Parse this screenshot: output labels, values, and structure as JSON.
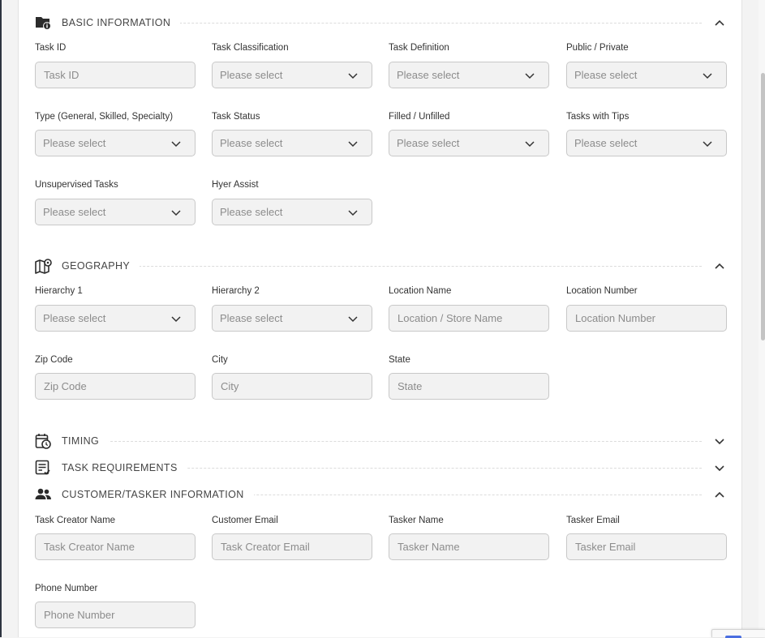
{
  "sections": {
    "basic": {
      "title": "BASIC INFORMATION",
      "icon": "folder-info-icon",
      "state": "expanded"
    },
    "geography": {
      "title": "GEOGRAPHY",
      "icon": "map-pin-icon",
      "state": "expanded"
    },
    "timing": {
      "title": "TIMING",
      "icon": "calendar-clock-icon",
      "state": "collapsed"
    },
    "requirements": {
      "title": "TASK REQUIREMENTS",
      "icon": "checklist-icon",
      "state": "collapsed"
    },
    "customer": {
      "title": "CUSTOMER/TASKER INFORMATION",
      "icon": "people-icon",
      "state": "expanded"
    }
  },
  "basic": {
    "task_id": {
      "label": "Task ID",
      "placeholder": "Task ID"
    },
    "task_classification": {
      "label": "Task Classification",
      "value": "Please select"
    },
    "task_definition": {
      "label": "Task Definition",
      "value": "Please select"
    },
    "public_private": {
      "label": "Public / Private",
      "value": "Please select"
    },
    "type": {
      "label": "Type (General, Skilled, Specialty)",
      "value": "Please select"
    },
    "task_status": {
      "label": "Task Status",
      "value": "Please select"
    },
    "filled": {
      "label": "Filled / Unfilled",
      "value": "Please select"
    },
    "tips": {
      "label": "Tasks with Tips",
      "value": "Please select"
    },
    "unsupervised": {
      "label": "Unsupervised Tasks",
      "value": "Please select"
    },
    "hyer_assist": {
      "label": "Hyer Assist",
      "value": "Please select"
    }
  },
  "geography": {
    "hierarchy1": {
      "label": "Hierarchy 1",
      "value": "Please select"
    },
    "hierarchy2": {
      "label": "Hierarchy 2",
      "value": "Please select"
    },
    "location_name": {
      "label": "Location Name",
      "placeholder": "Location / Store Name"
    },
    "location_number": {
      "label": "Location Number",
      "placeholder": "Location Number"
    },
    "zip": {
      "label": "Zip Code",
      "placeholder": "Zip Code"
    },
    "city": {
      "label": "City",
      "placeholder": "City"
    },
    "state": {
      "label": "State",
      "placeholder": "State"
    }
  },
  "customer": {
    "creator_name": {
      "label": "Task Creator Name",
      "placeholder": "Task Creator Name"
    },
    "customer_email": {
      "label": "Customer Email",
      "placeholder": "Task Creator Email"
    },
    "tasker_name": {
      "label": "Tasker Name",
      "placeholder": "Tasker Name"
    },
    "tasker_email": {
      "label": "Tasker Email",
      "placeholder": "Tasker Email"
    },
    "phone": {
      "label": "Phone Number",
      "placeholder": "Phone Number"
    }
  },
  "colors": {
    "text": "#333333",
    "field_bg": "#f2f2f2",
    "field_border": "#c8c8c8",
    "icon": "#2b2b2b"
  }
}
